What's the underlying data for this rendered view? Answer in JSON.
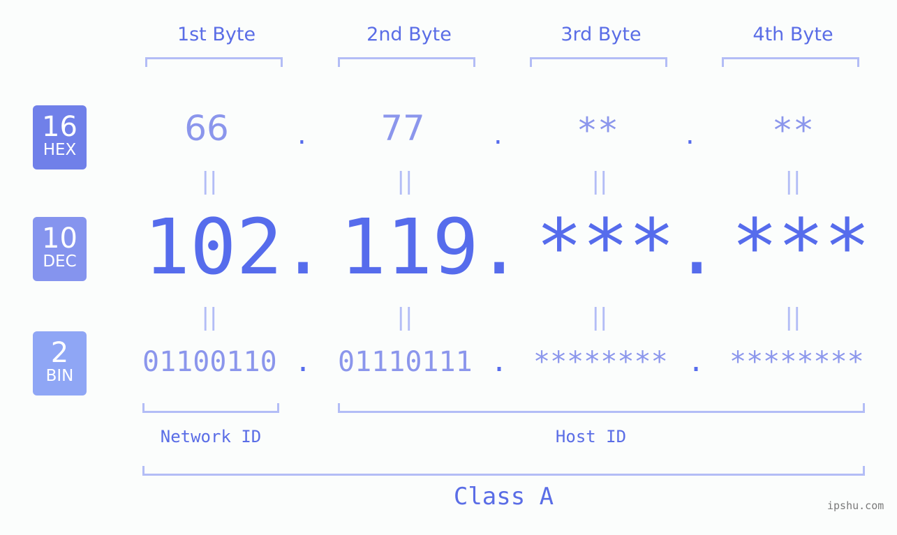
{
  "bytes": [
    "1st Byte",
    "2nd Byte",
    "3rd Byte",
    "4th Byte"
  ],
  "badges": {
    "hex": {
      "num": "16",
      "label": "HEX",
      "color": "#7080e9"
    },
    "dec": {
      "num": "10",
      "label": "DEC",
      "color": "#8594ee"
    },
    "bin": {
      "num": "2",
      "label": "BIN",
      "color": "#8fa6f5"
    }
  },
  "hex": [
    "66",
    "77",
    "**",
    "**"
  ],
  "dec": [
    "102",
    "119",
    "***",
    "***"
  ],
  "bin": [
    "01100110",
    "01110111",
    "********",
    "********"
  ],
  "separator": ".",
  "equals": "||",
  "network_id_label": "Network ID",
  "host_id_label": "Host ID",
  "class_label": "Class A",
  "watermark": "ipshu.com"
}
